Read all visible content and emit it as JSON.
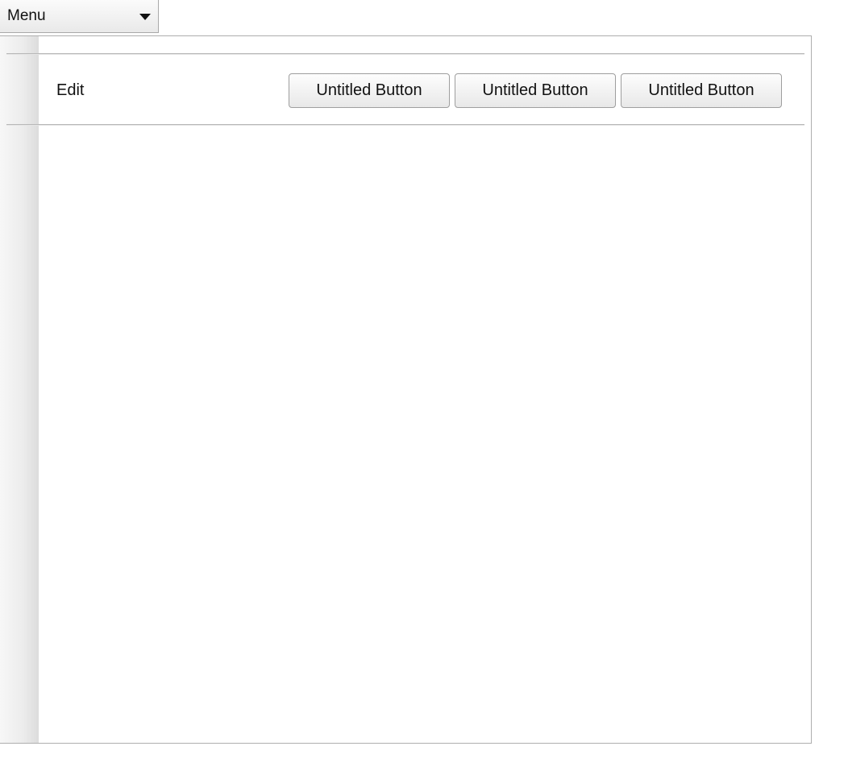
{
  "menu": {
    "label": "Menu",
    "icon": "chevron-down-icon"
  },
  "toolbar": {
    "title": "Edit",
    "buttons": [
      {
        "label": "Untitled Button"
      },
      {
        "label": "Untitled Button"
      },
      {
        "label": "Untitled Button"
      }
    ]
  }
}
